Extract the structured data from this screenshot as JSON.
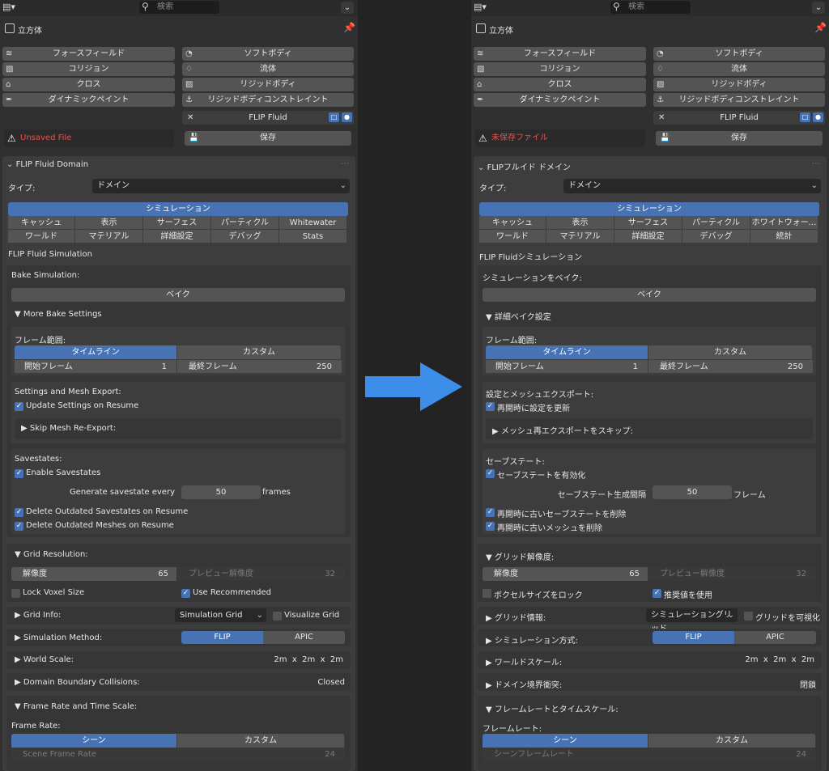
{
  "colors": {
    "accent": "#4772b3",
    "warning": "#e8544f",
    "arrow": "#3d8ee8"
  },
  "left": {
    "search_placeholder": "検索",
    "object_name": "立方体",
    "physics_buttons": [
      {
        "label": "フォースフィールド",
        "icon": "force-field-icon"
      },
      {
        "label": "ソフトボディ",
        "icon": "soft-body-icon"
      },
      {
        "label": "コリジョン",
        "icon": "collision-icon"
      },
      {
        "label": "流体",
        "icon": "fluid-icon"
      },
      {
        "label": "クロス",
        "icon": "cloth-icon"
      },
      {
        "label": "リジッドボディ",
        "icon": "rigid-body-icon"
      },
      {
        "label": "ダイナミックペイント",
        "icon": "dynamic-paint-icon"
      },
      {
        "label": "リジッドボディコンストレイント",
        "icon": "rigid-body-constraint-icon"
      }
    ],
    "flip_button": "FLIP Fluid",
    "warning": "Unsaved File",
    "save": "保存",
    "domain_title": "FLIP Fluid Domain",
    "type_label": "タイプ:",
    "type_value": "ドメイン",
    "tab_main": "シミュレーション",
    "tabs_row1": [
      "キャッシュ",
      "表示",
      "サーフェス",
      "パーティクル",
      "Whitewater"
    ],
    "tabs_row2": [
      "ワールド",
      "マテリアル",
      "詳細設定",
      "デバッグ",
      "Stats"
    ],
    "section_title": "FLIP Fluid Simulation",
    "bake_label": "Bake Simulation:",
    "bake_button": "ベイク",
    "more_bake": "More Bake Settings",
    "frame_range": "フレーム範囲:",
    "timeline": "タイムライン",
    "custom": "カスタム",
    "start_frame_label": "開始フレーム",
    "start_frame": "1",
    "end_frame_label": "最終フレーム",
    "end_frame": "250",
    "settings_export": "Settings and Mesh Export:",
    "update_settings": "Update Settings on Resume",
    "skip_mesh": "Skip Mesh Re-Export:",
    "savestates": "Savestates:",
    "enable_savestates": "Enable Savestates",
    "generate_every": "Generate savestate every",
    "savestate_interval": "50",
    "frames": "frames",
    "delete_savestates": "Delete Outdated Savestates on Resume",
    "delete_meshes": "Delete Outdated Meshes on Resume",
    "grid_resolution": "Grid Resolution:",
    "resolution_label": "解像度",
    "resolution": "65",
    "preview_label": "プレビュー解像度",
    "preview": "32",
    "lock_voxel": "Lock Voxel Size",
    "use_recommended": "Use Recommended",
    "grid_info": "Grid Info:",
    "grid_info_value": "Simulation Grid",
    "visualize_grid": "Visualize Grid",
    "sim_method": "Simulation Method:",
    "flip": "FLIP",
    "apic": "APIC",
    "world_scale": "World Scale:",
    "world_scale_value": "2m  x  2m  x  2m",
    "boundary": "Domain Boundary Collisions:",
    "boundary_value": "Closed",
    "frame_rate_scale": "Frame Rate and Time Scale:",
    "frame_rate": "Frame Rate:",
    "scene": "シーン",
    "custom2": "カスタム",
    "scene_rate_label": "Scene Frame Rate",
    "scene_rate": "24"
  },
  "right": {
    "search_placeholder": "検索",
    "object_name": "立方体",
    "physics_buttons": [
      {
        "label": "フォースフィールド",
        "icon": "force-field-icon"
      },
      {
        "label": "ソフトボディ",
        "icon": "soft-body-icon"
      },
      {
        "label": "コリジョン",
        "icon": "collision-icon"
      },
      {
        "label": "流体",
        "icon": "fluid-icon"
      },
      {
        "label": "クロス",
        "icon": "cloth-icon"
      },
      {
        "label": "リジッドボディ",
        "icon": "rigid-body-icon"
      },
      {
        "label": "ダイナミックペイント",
        "icon": "dynamic-paint-icon"
      },
      {
        "label": "リジッドボディコンストレイント",
        "icon": "rigid-body-constraint-icon"
      }
    ],
    "flip_button": "FLIP Fluid",
    "warning": "未保存ファイル",
    "save": "保存",
    "domain_title": "FLIPフルイド ドメイン",
    "type_label": "タイプ:",
    "type_value": "ドメイン",
    "tab_main": "シミュレーション",
    "tabs_row1": [
      "キャッシュ",
      "表示",
      "サーフェス",
      "パーティクル",
      "ホワイトウォー..."
    ],
    "tabs_row2": [
      "ワールド",
      "マテリアル",
      "詳細設定",
      "デバッグ",
      "統計"
    ],
    "section_title": "FLIP Fluidシミュレーション",
    "bake_label": "シミュレーションをベイク:",
    "bake_button": "ベイク",
    "more_bake": "詳細ベイク設定",
    "frame_range": "フレーム範囲:",
    "timeline": "タイムライン",
    "custom": "カスタム",
    "start_frame_label": "開始フレーム",
    "start_frame": "1",
    "end_frame_label": "最終フレーム",
    "end_frame": "250",
    "settings_export": "設定とメッシュエクスポート:",
    "update_settings": "再開時に設定を更新",
    "skip_mesh": "メッシュ再エクスポートをスキップ:",
    "savestates": "セーブステート:",
    "enable_savestates": "セーブステートを有効化",
    "generate_every": "セーブステート生成間隔",
    "savestate_interval": "50",
    "frames": "フレーム",
    "delete_savestates": "再開時に古いセーブステートを削除",
    "delete_meshes": "再開時に古いメッシュを削除",
    "grid_resolution": "グリッド解像度:",
    "resolution_label": "解像度",
    "resolution": "65",
    "preview_label": "プレビュー解像度",
    "preview": "32",
    "lock_voxel": "ボクセルサイズをロック",
    "use_recommended": "推奨値を使用",
    "grid_info": "グリッド情報:",
    "grid_info_value": "シミュレーショングリッド",
    "visualize_grid": "グリッドを可視化",
    "sim_method": "シミュレーション方式:",
    "flip": "FLIP",
    "apic": "APIC",
    "world_scale": "ワールドスケール:",
    "world_scale_value": "2m  x  2m  x  2m",
    "boundary": "ドメイン境界衝突:",
    "boundary_value": "閉鎖",
    "frame_rate_scale": "フレームレートとタイムスケール:",
    "frame_rate": "フレームレート:",
    "scene": "シーン",
    "custom2": "カスタム",
    "scene_rate_label": "シーンフレームレート",
    "scene_rate": "24"
  }
}
